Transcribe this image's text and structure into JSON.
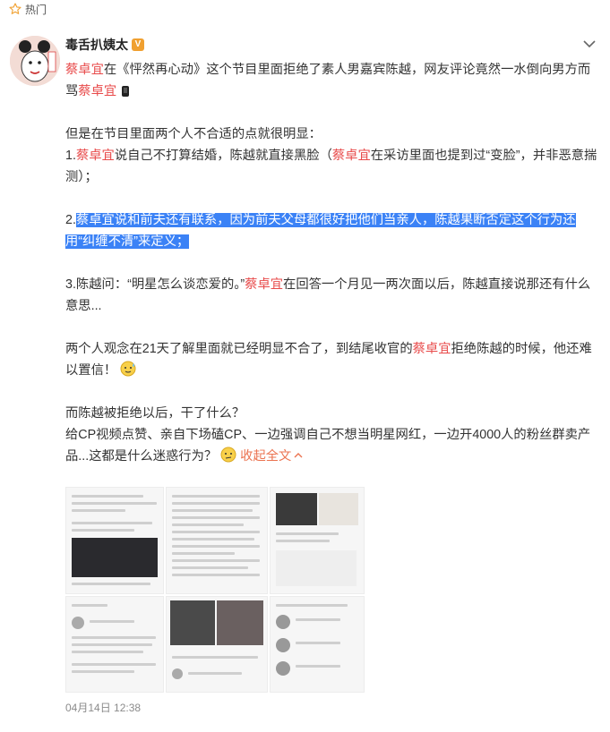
{
  "header": {
    "hot_label": "热门"
  },
  "post": {
    "author": "毒舌扒姨太",
    "verified_badge": "V",
    "paragraphs": [
      [
        {
          "t": "蔡卓宜",
          "k": 1
        },
        {
          "t": "在《怦然再心动》这个节目里面拒绝了素人男嘉宾陈越，网友评论竟然一水倒向男方而骂"
        },
        {
          "t": "蔡卓宜",
          "k": 1
        }
      ],
      [],
      [
        {
          "t": "但是在节目里面两个人不合适的点就很明显："
        }
      ],
      [
        {
          "t": "1."
        },
        {
          "t": "蔡卓宜",
          "k": 1
        },
        {
          "t": "说自己不打算结婚，陈越就直接黑脸（"
        },
        {
          "t": "蔡卓宜",
          "k": 1
        },
        {
          "t": "在采访里面也提到过“变脸”，并非恶意揣测）；"
        }
      ],
      [],
      [
        {
          "t": "2."
        },
        {
          "t": "蔡卓宜说和前夫还有联系，因为前夫父母都很好把他们当亲人，陈越果断否定这个行为还用“纠缠不清”来定义；",
          "h": 1
        }
      ],
      [],
      [
        {
          "t": "3.陈越问：“明星怎么谈恋爱的。”"
        },
        {
          "t": "蔡卓宜",
          "k": 1
        },
        {
          "t": "在回答一个月见一两次面以后，陈越直接说那还有什么意思..."
        }
      ],
      [],
      [
        {
          "t": "两个人观念在21天了解里面就已经明显不合了，到结尾收官的"
        },
        {
          "t": "蔡卓宜",
          "k": 1
        },
        {
          "t": "拒绝陈越的时候，他还难以置信！"
        }
      ],
      [],
      [
        {
          "t": "而陈越被拒绝以后，干了什么？"
        }
      ],
      [
        {
          "t": "给CP视频点赞、亲自下场磕CP、一边强调自己不想当明星网红，一边开4000人的粉丝群卖产品...这都是什么迷惑行为？"
        }
      ]
    ],
    "collapse_label": "收起全文",
    "date": "04月14日 12:38"
  },
  "icons": {
    "top": "star-icon",
    "more": "chevron-down-icon",
    "emojis": [
      "phone-emoji-icon",
      "sweat-emoji-icon",
      "confused-emoji-icon",
      "collapse-up-icon"
    ]
  },
  "colors": {
    "keyword": "#e84a4a",
    "highlight": "#3b82f6",
    "expand": "#eb7350",
    "date": "#8b8b8b"
  }
}
